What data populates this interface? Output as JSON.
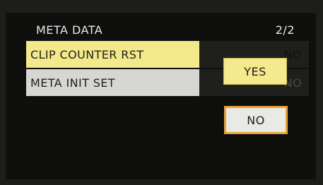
{
  "menu": {
    "title": "META DATA",
    "page_indicator": "2/2",
    "items": [
      {
        "label": "CLIP COUNTER RST",
        "value": "NO"
      },
      {
        "label": "META INIT SET",
        "value": "NO"
      }
    ]
  },
  "dialog": {
    "options": [
      {
        "label": "YES"
      },
      {
        "label": "NO"
      }
    ],
    "selected": "NO"
  },
  "colors": {
    "highlight": "#f3e88a",
    "selection_border": "#e8a23a",
    "background": "#1d1d1b"
  }
}
